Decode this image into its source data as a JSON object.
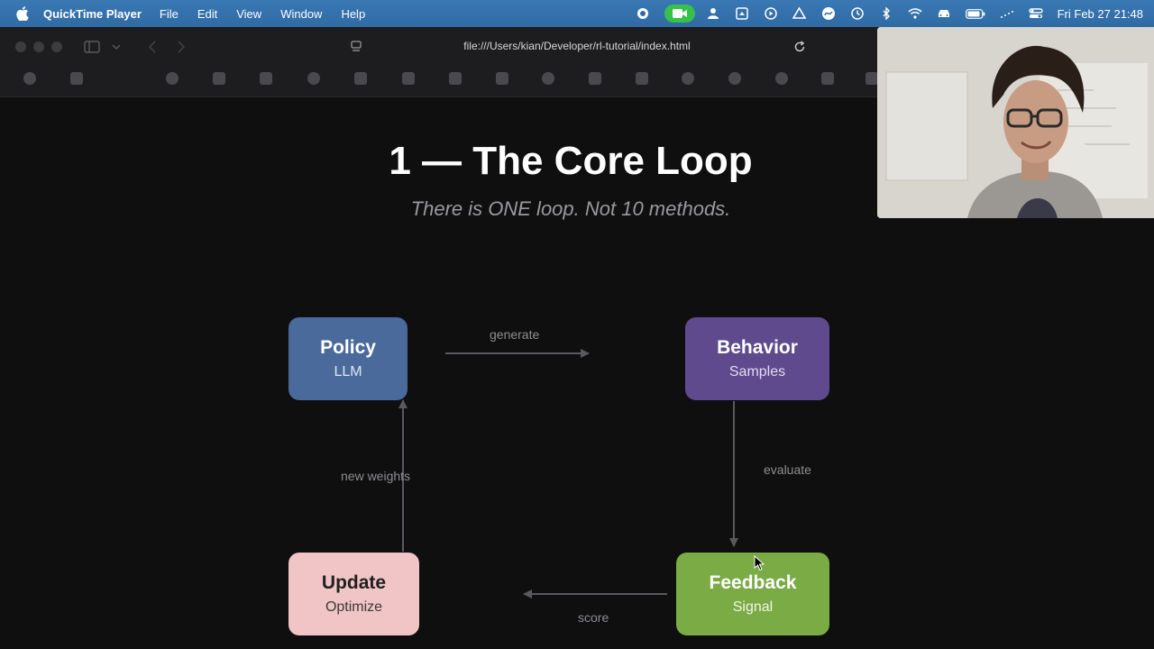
{
  "menubar": {
    "app_name": "QuickTime Player",
    "menus": [
      "File",
      "Edit",
      "View",
      "Window",
      "Help"
    ],
    "clock": "Fri Feb 27  21:48",
    "icons": [
      "apple-icon",
      "record-icon",
      "facetime-camera-icon",
      "person-icon",
      "window-icon",
      "play-icon",
      "drive-icon",
      "scribble-icon",
      "clock-icon",
      "bluetooth-icon",
      "wifi-icon",
      "car-icon",
      "battery-icon",
      "dots-icon",
      "control-center-icon"
    ]
  },
  "browser": {
    "url": "file:///Users/kian/Developer/rl-tutorial/index.html"
  },
  "slide": {
    "title": "1 — The Core Loop",
    "subtitle": "There is ONE loop. Not 10 methods.",
    "nodes": {
      "policy": {
        "title": "Policy",
        "subtitle": "LLM",
        "color": "#4a6a9c"
      },
      "behavior": {
        "title": "Behavior",
        "subtitle": "Samples",
        "color": "#5e4a8c"
      },
      "feedback": {
        "title": "Feedback",
        "subtitle": "Signal",
        "color": "#7aab45"
      },
      "update": {
        "title": "Update",
        "subtitle": "Optimize",
        "color": "#f1c4c6"
      }
    },
    "edges": {
      "generate": "generate",
      "evaluate": "evaluate",
      "score": "score",
      "new_weights": "new weights"
    }
  },
  "overlay": {
    "webcam": "webcam-feed"
  }
}
